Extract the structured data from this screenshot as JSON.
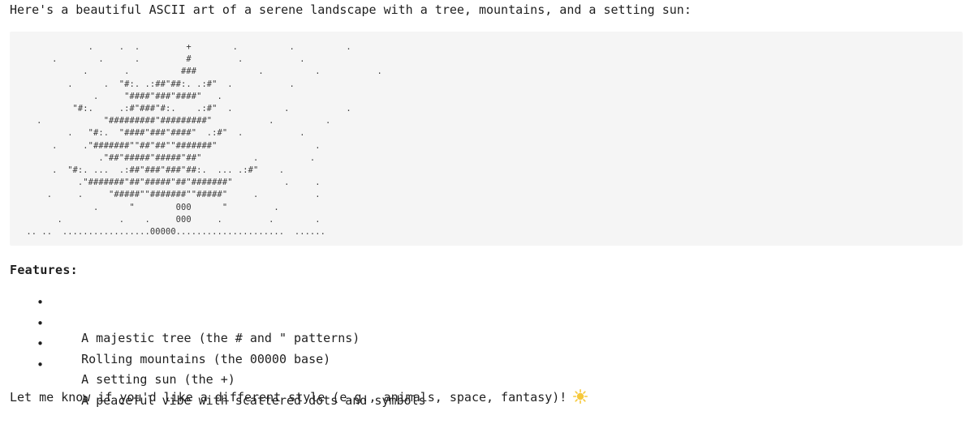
{
  "message": {
    "intro": "Here's a beautiful ASCII art of a serene landscape with a tree, mountains, and a setting sun:",
    "ascii_art": "             .     .  .         +        .          .          .\n      .        .      .         #         .           .\n            .       .          ###            .          .           .\n         .      .  \"#:. .:##\"##:. .:#\"  .           .\n              .     \"####\"###\"####\"   .\n          \"#:.     .:#\"###\"#:.    .:#\"  .          .           .\n   .            \"#########\"#########\"           .          .\n         .   \"#:.  \"####\"###\"####\"  .:#\"  .           .\n      .     .\"#######\"\"##\"##\"\"#######\"                   .\n               .\"##\"#####\"#####\"##\"          .          .\n      .  \"#:. ...  .:##\"###\"###\"##:.  ... .:#\"    .\n           .\"#######\"##\"#####\"##\"#######\"          .     .\n     .     .     \"#####\"\"#######\"\"#####\"     .           .\n              .      \"        000      \"         .\n       .           .    .     000     .         .        .\n .. ..  .................00000.....................  ......",
    "features_heading": "Features:",
    "features": [
      "A majestic tree (the # and \" patterns)",
      "Rolling mountains (the 00000 base)",
      "A setting sun (the +)",
      "A peaceful vibe with scattered dots and symbols"
    ],
    "bullet_glyph": "•",
    "outro": "Let me know if you'd like a different style (e.g., animals, space, fantasy)!",
    "outro_icon": "sun-emoji-icon"
  },
  "colors": {
    "text": "#1f1f1f",
    "code_background": "#f5f5f5",
    "sun": "#f6c83a"
  }
}
